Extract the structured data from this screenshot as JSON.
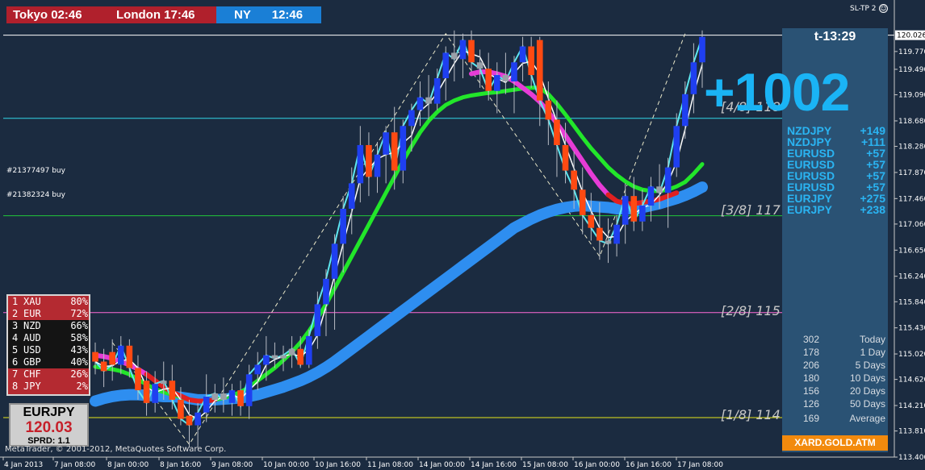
{
  "sessions": {
    "tokyo": "Tokyo 02:46",
    "london": "London 17:46",
    "ny_name": "NY",
    "ny_time": "12:46"
  },
  "indicator_label": "SL-TP 2",
  "orders": [
    {
      "label": "#21377497 buy",
      "price": 117.74
    },
    {
      "label": "#21382324 buy",
      "price": 117.19
    }
  ],
  "fib_levels": [
    {
      "label": "[4/8] 118",
      "price": 118.72,
      "color": "#33d6e8"
    },
    {
      "label": "[3/8] 117",
      "price": 117.19,
      "color": "#22c83a"
    },
    {
      "label": "[2/8] 115",
      "price": 115.67,
      "color": "#ff6ad6"
    },
    {
      "label": "[1/8] 114",
      "price": 114.02,
      "color": "#e6e61a"
    }
  ],
  "big_profit": "+1002",
  "info_panel": {
    "timer": "t-13:29",
    "pairs": [
      {
        "symbol": "NZDJPY",
        "value": "+149"
      },
      {
        "symbol": "NZDJPY",
        "value": "+111"
      },
      {
        "symbol": "EURUSD",
        "value": "+57"
      },
      {
        "symbol": "EURUSD",
        "value": "+57"
      },
      {
        "symbol": "EURUSD",
        "value": "+57"
      },
      {
        "symbol": "EURUSD",
        "value": "+57"
      },
      {
        "symbol": "EURJPY",
        "value": "+275"
      },
      {
        "symbol": "EURJPY",
        "value": "+238"
      }
    ],
    "stats": [
      {
        "n": "302",
        "label": "Today"
      },
      {
        "n": "178",
        "label": "1 Day"
      },
      {
        "n": "206",
        "label": "5 Days"
      },
      {
        "n": "180",
        "label": "10 Days"
      },
      {
        "n": "156",
        "label": "20 Days"
      },
      {
        "n": "126",
        "label": "50 Days"
      },
      {
        "n": "169",
        "label": "Average"
      }
    ],
    "footer": "XARD.GOLD.ATM"
  },
  "strength": [
    {
      "rank": "1",
      "ccy": "XAU",
      "pct": "80%",
      "dark": false
    },
    {
      "rank": "2",
      "ccy": "EUR",
      "pct": "72%",
      "dark": false
    },
    {
      "rank": "3",
      "ccy": "NZD",
      "pct": "66%",
      "dark": true
    },
    {
      "rank": "4",
      "ccy": "AUD",
      "pct": "58%",
      "dark": true
    },
    {
      "rank": "5",
      "ccy": "USD",
      "pct": "43%",
      "dark": true
    },
    {
      "rank": "6",
      "ccy": "GBP",
      "pct": "40%",
      "dark": true
    },
    {
      "rank": "7",
      "ccy": "CHF",
      "pct": "26%",
      "dark": false
    },
    {
      "rank": "8",
      "ccy": "JPY",
      "pct": "2%",
      "dark": false
    }
  ],
  "symbol_box": {
    "symbol": "EURJPY",
    "price": "120.03",
    "spread": "SPRD: 1.1"
  },
  "copyright": "MetaTrader, © 2001-2012, MetaQuotes Software Corp.",
  "chart_data": {
    "type": "candlestick",
    "symbol": "EURJPY",
    "current_price": 120.026,
    "current_price_label": "120.026",
    "ylim": [
      113.4,
      120.3
    ],
    "y_ticks": [
      "119.770",
      "119.490",
      "119.090",
      "118.680",
      "118.280",
      "117.870",
      "117.460",
      "117.060",
      "116.650",
      "116.240",
      "115.840",
      "115.430",
      "115.020",
      "114.620",
      "114.210",
      "113.810",
      "113.400"
    ],
    "x_ticks": [
      "4 Jan 2013",
      "7 Jan 08:00",
      "8 Jan 00:00",
      "8 Jan 16:00",
      "9 Jan 08:00",
      "10 Jan 00:00",
      "10 Jan 16:00",
      "11 Jan 08:00",
      "14 Jan 00:00",
      "14 Jan 16:00",
      "15 Jan 08:00",
      "16 Jan 00:00",
      "16 Jan 16:00",
      "17 Jan 08:00"
    ],
    "candles": [
      {
        "o": 115.05,
        "h": 115.2,
        "l": 114.7,
        "c": 114.9
      },
      {
        "o": 114.9,
        "h": 115.1,
        "l": 114.5,
        "c": 114.75
      },
      {
        "o": 115.05,
        "h": 115.25,
        "l": 114.6,
        "c": 114.85
      },
      {
        "o": 114.85,
        "h": 115.3,
        "l": 114.7,
        "c": 115.15
      },
      {
        "o": 115.15,
        "h": 115.25,
        "l": 114.65,
        "c": 114.8
      },
      {
        "o": 114.8,
        "h": 115.0,
        "l": 114.3,
        "c": 114.45
      },
      {
        "o": 114.6,
        "h": 114.75,
        "l": 114.05,
        "c": 114.25
      },
      {
        "o": 114.25,
        "h": 114.75,
        "l": 114.1,
        "c": 114.55
      },
      {
        "o": 114.55,
        "h": 114.9,
        "l": 114.3,
        "c": 114.6
      },
      {
        "o": 114.6,
        "h": 114.85,
        "l": 114.15,
        "c": 114.3
      },
      {
        "o": 114.3,
        "h": 114.5,
        "l": 113.9,
        "c": 114.0
      },
      {
        "o": 114.05,
        "h": 114.3,
        "l": 113.55,
        "c": 113.9
      },
      {
        "o": 113.9,
        "h": 114.25,
        "l": 113.55,
        "c": 114.1
      },
      {
        "o": 114.1,
        "h": 114.7,
        "l": 113.95,
        "c": 114.35
      },
      {
        "o": 114.3,
        "h": 114.55,
        "l": 114.1,
        "c": 114.4
      },
      {
        "o": 114.4,
        "h": 114.65,
        "l": 114.1,
        "c": 114.3
      },
      {
        "o": 114.25,
        "h": 114.55,
        "l": 114.05,
        "c": 114.45
      },
      {
        "o": 114.45,
        "h": 114.6,
        "l": 114.05,
        "c": 114.2
      },
      {
        "o": 114.2,
        "h": 114.85,
        "l": 114.0,
        "c": 114.7
      },
      {
        "o": 114.7,
        "h": 115.05,
        "l": 114.45,
        "c": 114.85
      },
      {
        "o": 114.85,
        "h": 115.3,
        "l": 114.6,
        "c": 115.0
      },
      {
        "o": 115.0,
        "h": 115.2,
        "l": 114.8,
        "c": 114.95
      },
      {
        "o": 114.95,
        "h": 115.15,
        "l": 114.75,
        "c": 115.0
      },
      {
        "o": 115.0,
        "h": 115.3,
        "l": 114.8,
        "c": 115.1
      },
      {
        "o": 115.1,
        "h": 115.3,
        "l": 114.8,
        "c": 114.85
      },
      {
        "o": 114.85,
        "h": 115.4,
        "l": 114.8,
        "c": 115.3
      },
      {
        "o": 115.3,
        "h": 116.0,
        "l": 115.1,
        "c": 115.8
      },
      {
        "o": 115.8,
        "h": 116.35,
        "l": 115.3,
        "c": 116.2
      },
      {
        "o": 116.2,
        "h": 116.9,
        "l": 115.4,
        "c": 116.75
      },
      {
        "o": 116.75,
        "h": 117.5,
        "l": 116.3,
        "c": 117.3
      },
      {
        "o": 117.3,
        "h": 117.95,
        "l": 116.9,
        "c": 117.7
      },
      {
        "o": 117.7,
        "h": 118.6,
        "l": 117.4,
        "c": 118.3
      },
      {
        "o": 118.3,
        "h": 118.5,
        "l": 117.5,
        "c": 117.8
      },
      {
        "o": 117.8,
        "h": 118.35,
        "l": 117.55,
        "c": 118.15
      },
      {
        "o": 118.15,
        "h": 118.6,
        "l": 117.7,
        "c": 118.5
      },
      {
        "o": 118.5,
        "h": 118.9,
        "l": 117.6,
        "c": 117.9
      },
      {
        "o": 117.9,
        "h": 118.7,
        "l": 117.7,
        "c": 118.6
      },
      {
        "o": 118.6,
        "h": 118.95,
        "l": 118.2,
        "c": 118.85
      },
      {
        "o": 118.85,
        "h": 119.3,
        "l": 118.6,
        "c": 119.05
      },
      {
        "o": 119.05,
        "h": 119.4,
        "l": 118.7,
        "c": 118.95
      },
      {
        "o": 118.95,
        "h": 119.5,
        "l": 118.85,
        "c": 119.35
      },
      {
        "o": 119.35,
        "h": 119.85,
        "l": 119.0,
        "c": 119.75
      },
      {
        "o": 119.75,
        "h": 120.1,
        "l": 119.3,
        "c": 119.65
      },
      {
        "o": 119.65,
        "h": 120.05,
        "l": 119.35,
        "c": 119.95
      },
      {
        "o": 119.95,
        "h": 120.1,
        "l": 119.45,
        "c": 119.6
      },
      {
        "o": 119.6,
        "h": 119.8,
        "l": 119.2,
        "c": 119.5
      },
      {
        "o": 119.5,
        "h": 119.75,
        "l": 119.0,
        "c": 119.15
      },
      {
        "o": 119.15,
        "h": 119.6,
        "l": 118.8,
        "c": 119.4
      },
      {
        "o": 119.4,
        "h": 119.75,
        "l": 119.1,
        "c": 119.3
      },
      {
        "o": 119.3,
        "h": 119.7,
        "l": 118.8,
        "c": 119.6
      },
      {
        "o": 119.6,
        "h": 120.0,
        "l": 119.3,
        "c": 119.85
      },
      {
        "o": 119.85,
        "h": 120.0,
        "l": 119.2,
        "c": 119.4
      },
      {
        "o": 119.95,
        "h": 120.0,
        "l": 118.6,
        "c": 119.0
      },
      {
        "o": 119.0,
        "h": 119.3,
        "l": 118.3,
        "c": 118.7
      },
      {
        "o": 118.7,
        "h": 119.0,
        "l": 117.8,
        "c": 118.3
      },
      {
        "o": 118.3,
        "h": 118.65,
        "l": 117.7,
        "c": 117.9
      },
      {
        "o": 117.9,
        "h": 118.2,
        "l": 117.3,
        "c": 117.6
      },
      {
        "o": 117.6,
        "h": 117.95,
        "l": 116.9,
        "c": 117.2
      },
      {
        "o": 117.2,
        "h": 117.55,
        "l": 116.8,
        "c": 117.0
      },
      {
        "o": 117.0,
        "h": 117.4,
        "l": 116.5,
        "c": 116.8
      },
      {
        "o": 116.8,
        "h": 117.15,
        "l": 116.45,
        "c": 116.75
      },
      {
        "o": 116.75,
        "h": 117.2,
        "l": 116.55,
        "c": 117.05
      },
      {
        "o": 117.05,
        "h": 117.7,
        "l": 116.75,
        "c": 117.5
      },
      {
        "o": 117.5,
        "h": 117.8,
        "l": 116.95,
        "c": 117.1
      },
      {
        "o": 117.1,
        "h": 117.6,
        "l": 116.95,
        "c": 117.35
      },
      {
        "o": 117.35,
        "h": 117.8,
        "l": 117.1,
        "c": 117.65
      },
      {
        "o": 117.65,
        "h": 118.0,
        "l": 117.3,
        "c": 117.55
      },
      {
        "o": 117.55,
        "h": 118.1,
        "l": 117.0,
        "c": 117.95
      },
      {
        "o": 117.95,
        "h": 118.8,
        "l": 117.8,
        "c": 118.6
      },
      {
        "o": 118.6,
        "h": 119.3,
        "l": 118.4,
        "c": 119.1
      },
      {
        "o": 119.1,
        "h": 119.9,
        "l": 118.8,
        "c": 119.6
      },
      {
        "o": 119.6,
        "h": 120.1,
        "l": 119.2,
        "c": 120.0
      }
    ],
    "series": [
      {
        "name": "slow-ma",
        "color": "#2e8ef0",
        "values": [
          114.28,
          114.32,
          114.35,
          114.37,
          114.38,
          114.38,
          114.37,
          114.36,
          114.35,
          114.35,
          114.34,
          114.32,
          114.3,
          114.3,
          114.3,
          114.31,
          114.32,
          114.33,
          114.35,
          114.38,
          114.42,
          114.46,
          114.5,
          114.55,
          114.6,
          114.66,
          114.73,
          114.81,
          114.9,
          115.0,
          115.1,
          115.2,
          115.3,
          115.4,
          115.5,
          115.6,
          115.7,
          115.8,
          115.9,
          116.0,
          116.1,
          116.2,
          116.3,
          116.4,
          116.5,
          116.6,
          116.7,
          116.8,
          116.9,
          117.0,
          117.07,
          117.14,
          117.2,
          117.25,
          117.29,
          117.32,
          117.34,
          117.35,
          117.34,
          117.33,
          117.32,
          117.3,
          117.3,
          117.3,
          117.32,
          117.35,
          117.38,
          117.42,
          117.46,
          117.51,
          117.57,
          117.64
        ]
      },
      {
        "name": "fast-ma",
        "color": "#22e62a",
        "values": [
          114.82,
          114.8,
          114.78,
          114.75,
          114.7,
          114.62,
          114.54,
          114.47,
          114.42,
          114.38,
          114.34,
          114.3,
          114.28,
          114.28,
          114.3,
          114.33,
          114.37,
          114.42,
          114.5,
          114.6,
          114.7,
          114.8,
          114.92,
          115.05,
          115.2,
          115.38,
          115.58,
          115.8,
          116.05,
          116.3,
          116.55,
          116.8,
          117.05,
          117.3,
          117.55,
          117.8,
          118.05,
          118.28,
          118.5,
          118.68,
          118.82,
          118.93,
          119.0,
          119.05,
          119.08,
          119.1,
          119.12,
          119.13,
          119.15,
          119.17,
          119.19,
          119.2,
          119.2,
          119.1,
          118.95,
          118.78,
          118.6,
          118.42,
          118.25,
          118.1,
          117.95,
          117.83,
          117.73,
          117.65,
          117.6,
          117.58,
          117.58,
          117.6,
          117.65,
          117.72,
          117.85,
          118.0
        ]
      },
      {
        "name": "trend-ma",
        "color": "#e63cd6",
        "colors": [
          "#e02020",
          "#e63cd6"
        ],
        "values": [
          115.0,
          114.98,
          114.95,
          114.9,
          114.85,
          114.78,
          114.7,
          114.6,
          114.5,
          114.42,
          114.36,
          114.3,
          114.28,
          114.28,
          114.3,
          114.32,
          114.35,
          114.4,
          114.5,
          114.6,
          114.72,
          114.85,
          115.0,
          115.15,
          115.32,
          115.5,
          115.7,
          115.92,
          116.15,
          116.4,
          116.65,
          116.9,
          117.15,
          117.4,
          117.65,
          117.9,
          118.15,
          118.38,
          118.6,
          118.8,
          118.98,
          119.12,
          119.25,
          119.35,
          119.42,
          119.45,
          119.45,
          119.42,
          119.38,
          119.3,
          119.2,
          119.1,
          118.98,
          118.82,
          118.64,
          118.45,
          118.25,
          118.05,
          117.85,
          117.67,
          117.52,
          117.42,
          117.38,
          117.38,
          117.4,
          117.42,
          117.45,
          117.5,
          117.55
        ]
      }
    ]
  }
}
